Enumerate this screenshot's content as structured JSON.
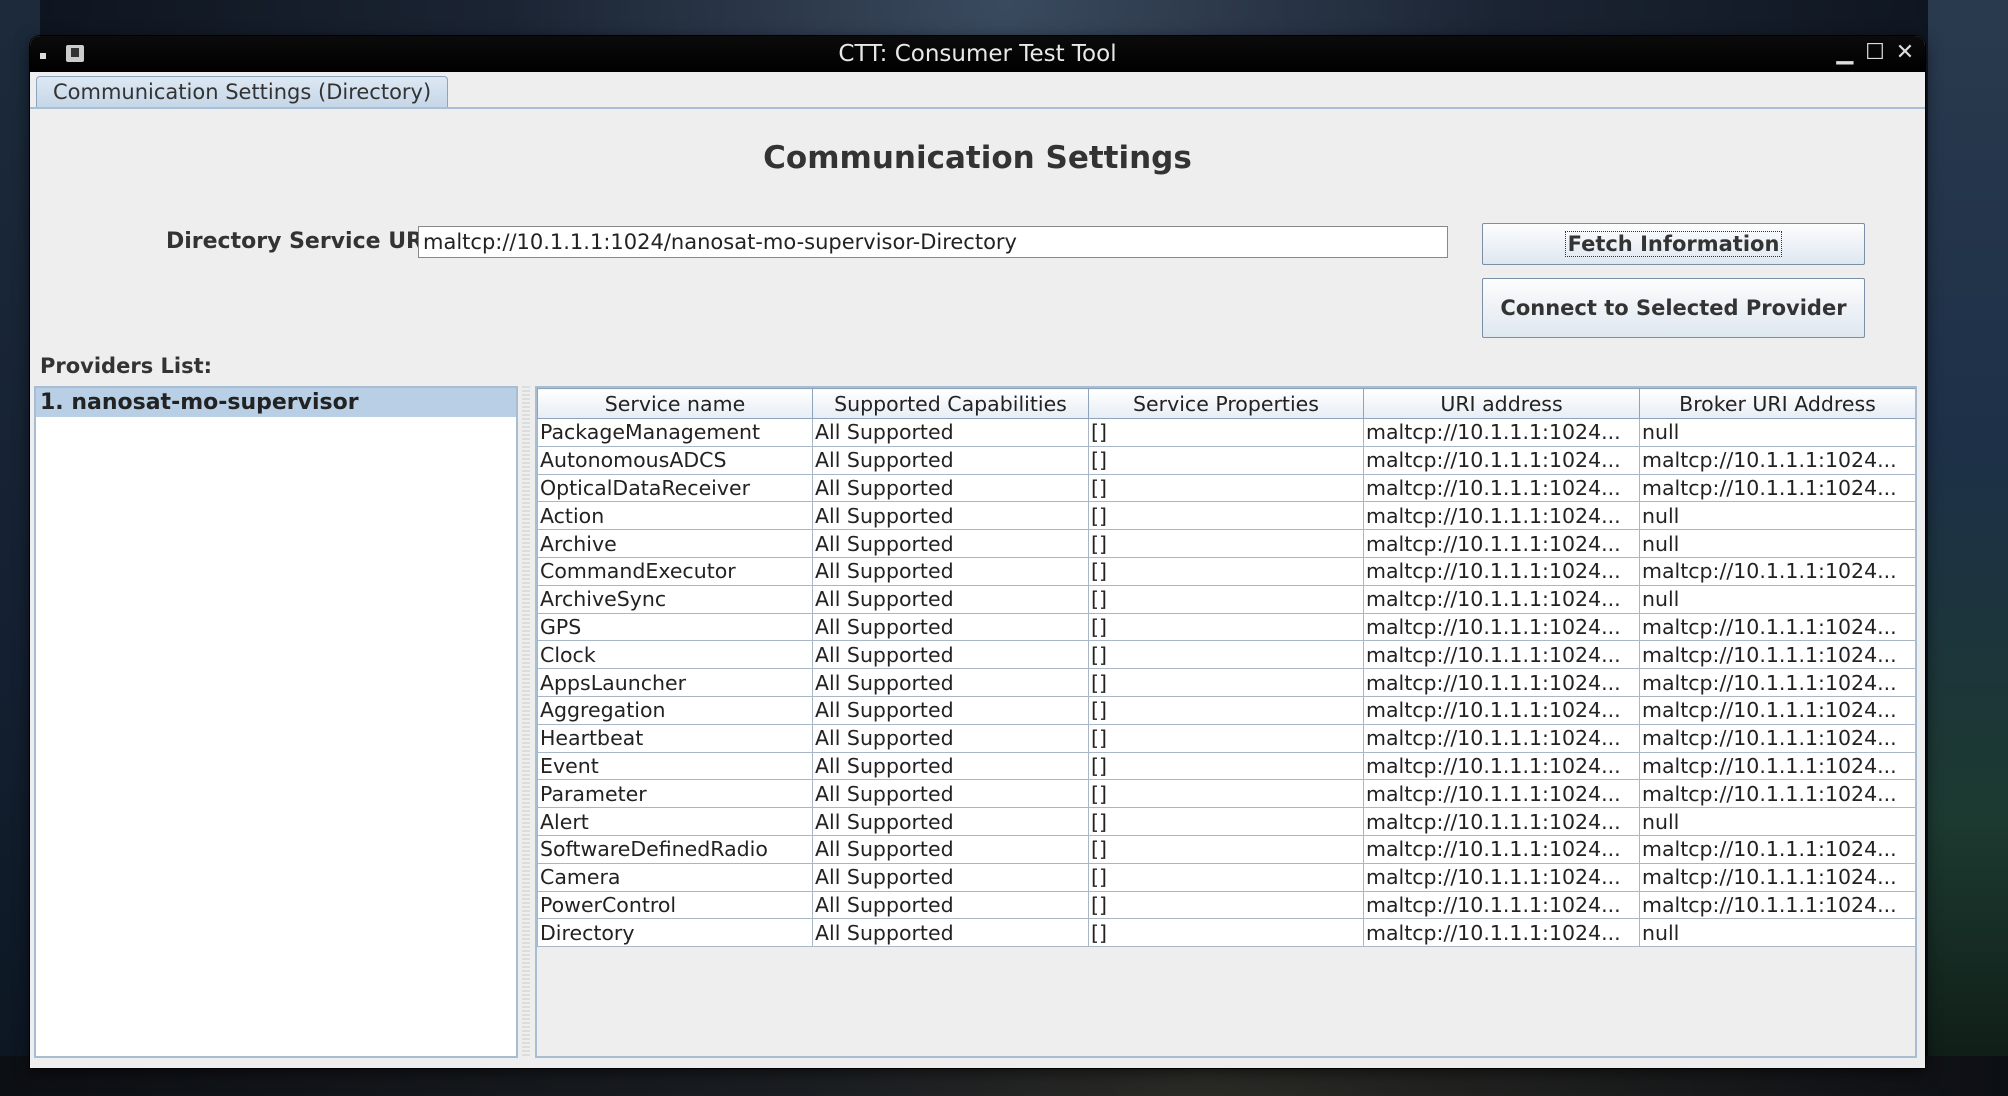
{
  "window": {
    "title": "CTT: Consumer Test Tool",
    "controls": {
      "minimize": "▁",
      "maximize": "☐",
      "close": "✕"
    }
  },
  "tabs": [
    {
      "label": "Communication Settings (Directory)",
      "active": true
    }
  ],
  "main": {
    "heading": "Communication Settings",
    "uri_label": "Directory Service URI:",
    "uri_value": "maltcp://10.1.1.1:1024/nanosat-mo-supervisor-Directory",
    "fetch_button": "Fetch Information",
    "connect_button": "Connect to Selected Provider",
    "providers_label": "Providers List:",
    "providers": [
      "1. nanosat-mo-supervisor"
    ]
  },
  "table": {
    "columns": [
      "Service name",
      "Supported Capabilities",
      "Service Properties",
      "URI address",
      "Broker URI Address"
    ],
    "rows": [
      [
        "PackageManagement",
        "All Supported",
        "[]",
        "maltcp://10.1.1.1:1024...",
        "null"
      ],
      [
        "AutonomousADCS",
        "All Supported",
        "[]",
        "maltcp://10.1.1.1:1024...",
        "maltcp://10.1.1.1:1024..."
      ],
      [
        "OpticalDataReceiver",
        "All Supported",
        "[]",
        "maltcp://10.1.1.1:1024...",
        "maltcp://10.1.1.1:1024..."
      ],
      [
        "Action",
        "All Supported",
        "[]",
        "maltcp://10.1.1.1:1024...",
        "null"
      ],
      [
        "Archive",
        "All Supported",
        "[]",
        "maltcp://10.1.1.1:1024...",
        "null"
      ],
      [
        "CommandExecutor",
        "All Supported",
        "[]",
        "maltcp://10.1.1.1:1024...",
        "maltcp://10.1.1.1:1024..."
      ],
      [
        "ArchiveSync",
        "All Supported",
        "[]",
        "maltcp://10.1.1.1:1024...",
        "null"
      ],
      [
        "GPS",
        "All Supported",
        "[]",
        "maltcp://10.1.1.1:1024...",
        "maltcp://10.1.1.1:1024..."
      ],
      [
        "Clock",
        "All Supported",
        "[]",
        "maltcp://10.1.1.1:1024...",
        "maltcp://10.1.1.1:1024..."
      ],
      [
        "AppsLauncher",
        "All Supported",
        "[]",
        "maltcp://10.1.1.1:1024...",
        "maltcp://10.1.1.1:1024..."
      ],
      [
        "Aggregation",
        "All Supported",
        "[]",
        "maltcp://10.1.1.1:1024...",
        "maltcp://10.1.1.1:1024..."
      ],
      [
        "Heartbeat",
        "All Supported",
        "[]",
        "maltcp://10.1.1.1:1024...",
        "maltcp://10.1.1.1:1024..."
      ],
      [
        "Event",
        "All Supported",
        "[]",
        "maltcp://10.1.1.1:1024...",
        "maltcp://10.1.1.1:1024..."
      ],
      [
        "Parameter",
        "All Supported",
        "[]",
        "maltcp://10.1.1.1:1024...",
        "maltcp://10.1.1.1:1024..."
      ],
      [
        "Alert",
        "All Supported",
        "[]",
        "maltcp://10.1.1.1:1024...",
        "null"
      ],
      [
        "SoftwareDefinedRadio",
        "All Supported",
        "[]",
        "maltcp://10.1.1.1:1024...",
        "maltcp://10.1.1.1:1024..."
      ],
      [
        "Camera",
        "All Supported",
        "[]",
        "maltcp://10.1.1.1:1024...",
        "maltcp://10.1.1.1:1024..."
      ],
      [
        "PowerControl",
        "All Supported",
        "[]",
        "maltcp://10.1.1.1:1024...",
        "maltcp://10.1.1.1:1024..."
      ],
      [
        "Directory",
        "All Supported",
        "[]",
        "maltcp://10.1.1.1:1024...",
        "null"
      ]
    ]
  },
  "colors": {
    "window_bg": "#eeeeee",
    "tab_bg": "#c5d6e8",
    "selection": "#b8cfe5",
    "titlebar": "#000000"
  }
}
